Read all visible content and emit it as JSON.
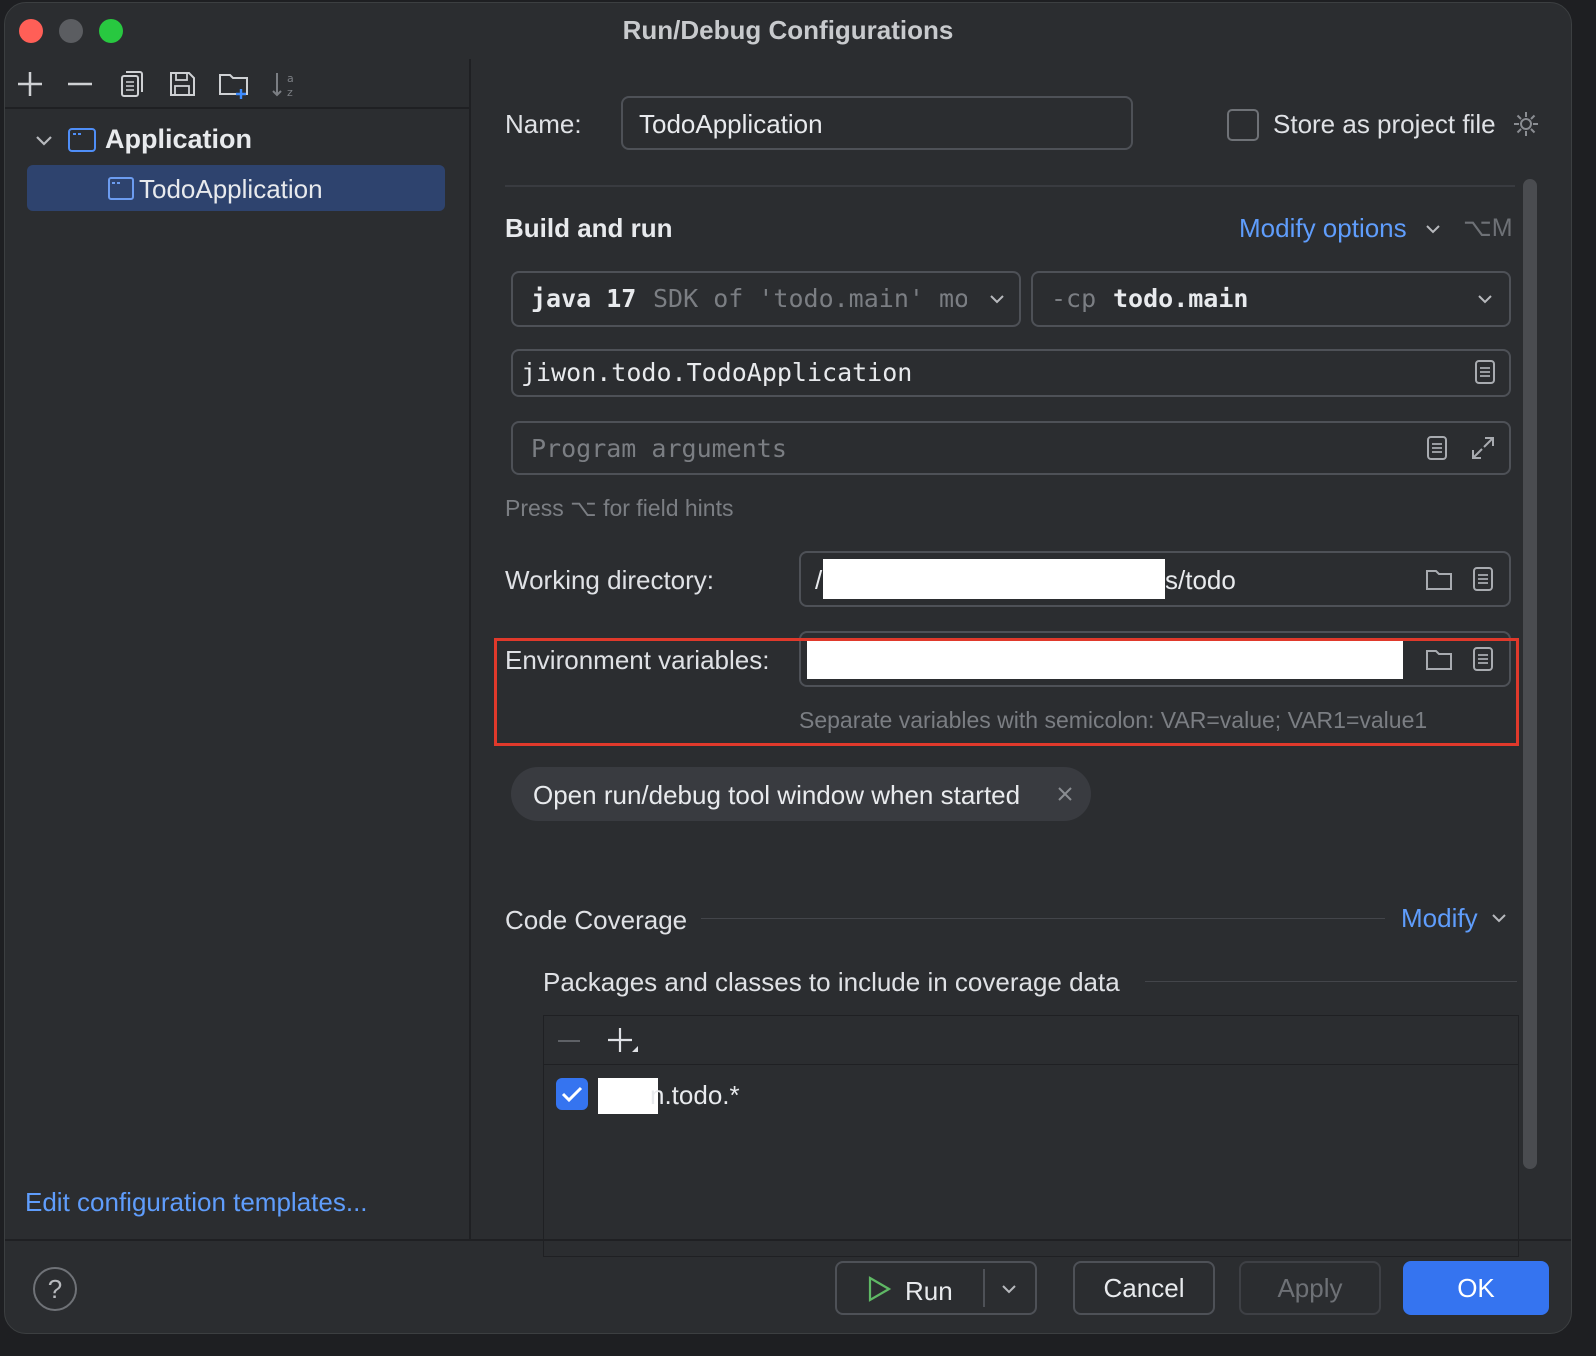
{
  "window": {
    "title": "Run/Debug Configurations"
  },
  "toolbar": {
    "add": "add-icon",
    "remove": "remove-icon",
    "copy": "copy-icon",
    "save": "save-icon",
    "new_folder": "new-folder-icon",
    "sort": "sort-icon"
  },
  "tree": {
    "group_label": "Application",
    "items": [
      {
        "label": "TodoApplication",
        "selected": true
      }
    ]
  },
  "left_footer": {
    "edit_templates_label": "Edit configuration templates..."
  },
  "form": {
    "name_label": "Name:",
    "name_value": "TodoApplication",
    "store_project_file_label": "Store as project file",
    "store_project_file_checked": false,
    "section_build_run": "Build and run",
    "modify_options_label": "Modify options",
    "modify_options_shortcut": "⌥M",
    "jre": {
      "prefix": "java 17",
      "suffix": "SDK of 'todo.main' mo"
    },
    "classpath": {
      "flag": "-cp",
      "module": "todo.main"
    },
    "main_class": "jiwon.todo.TodoApplication",
    "program_args_placeholder": "Program arguments",
    "hint_text": "Press ⌥ for field hints",
    "working_dir_label": "Working directory:",
    "working_dir_prefix": "/",
    "working_dir_suffix": "s/todo",
    "env_label": "Environment variables:",
    "env_hint": "Separate variables with semicolon: VAR=value; VAR1=value1",
    "chip_label": "Open run/debug tool window when started",
    "code_coverage_label": "Code Coverage",
    "modify_label": "Modify",
    "coverage_packages_label": "Packages and classes to include in coverage data",
    "coverage_items": [
      {
        "visible_text": "n.todo.*",
        "checked": true
      }
    ]
  },
  "footer": {
    "run_label": "Run",
    "cancel_label": "Cancel",
    "apply_label": "Apply",
    "ok_label": "OK",
    "help_symbol": "?"
  },
  "colors": {
    "accent": "#3574f0",
    "link": "#5f9dfc",
    "highlight_border": "#e0392b",
    "selection": "#2e436e"
  }
}
